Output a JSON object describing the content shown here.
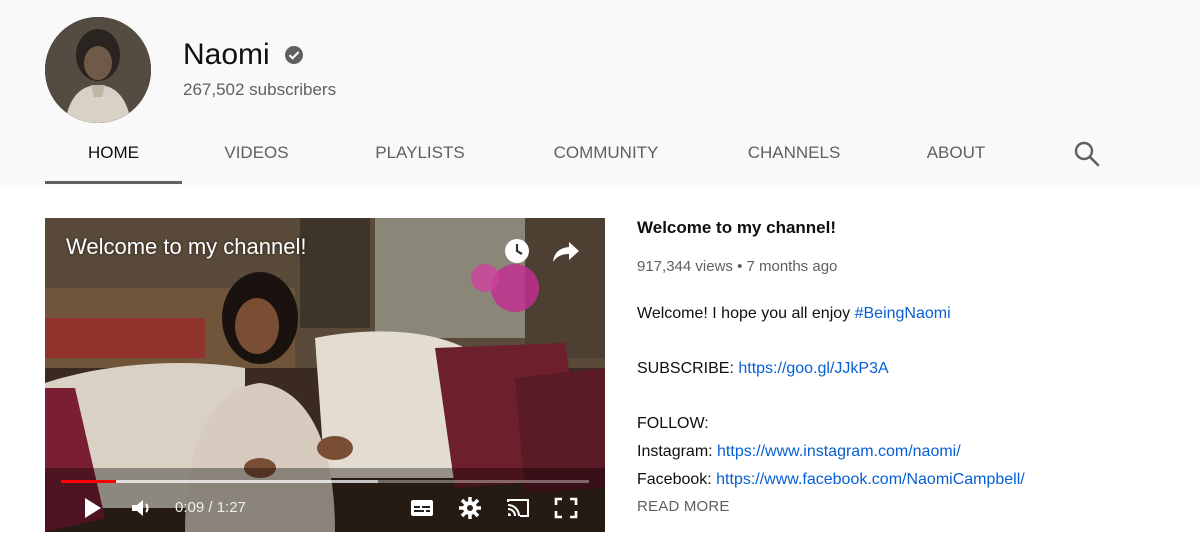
{
  "channel": {
    "name": "Naomi",
    "subscribers": "267,502 subscribers"
  },
  "tabs": [
    {
      "label": "HOME",
      "active": true
    },
    {
      "label": "VIDEOS"
    },
    {
      "label": "PLAYLISTS"
    },
    {
      "label": "COMMUNITY"
    },
    {
      "label": "CHANNELS"
    },
    {
      "label": "ABOUT"
    }
  ],
  "icons": {
    "verified": "verified-check-icon",
    "search": "search-icon",
    "watch_later": "clock-icon",
    "share": "share-arrow-icon",
    "play": "play-icon",
    "volume": "volume-icon",
    "captions": "captions-icon",
    "settings": "gear-icon",
    "cast": "cast-icon",
    "fullscreen": "fullscreen-icon"
  },
  "player": {
    "overlay_title": "Welcome to my channel!",
    "time": "0:09 / 1:27",
    "progress_fraction": 0.1034,
    "buffer_fraction": 0.6
  },
  "video": {
    "title": "Welcome to my channel!",
    "meta": "917,344 views • 7 months ago",
    "desc_intro": "Welcome! I hope you all enjoy ",
    "hashtag": "#BeingNaomi",
    "subscribe_label": "SUBSCRIBE: ",
    "subscribe_link": "https://goo.gl/JJkP3A",
    "follow_label": "FOLLOW:",
    "instagram_label": "Instagram: ",
    "instagram_link": "https://www.instagram.com/naomi/",
    "facebook_label": "Facebook: ",
    "facebook_link": "https://www.facebook.com/NaomiCampbell/",
    "read_more": "READ MORE"
  },
  "colors": {
    "link": "#065fd4",
    "progress": "#ff0000",
    "header_bg": "#f9f9f9"
  }
}
